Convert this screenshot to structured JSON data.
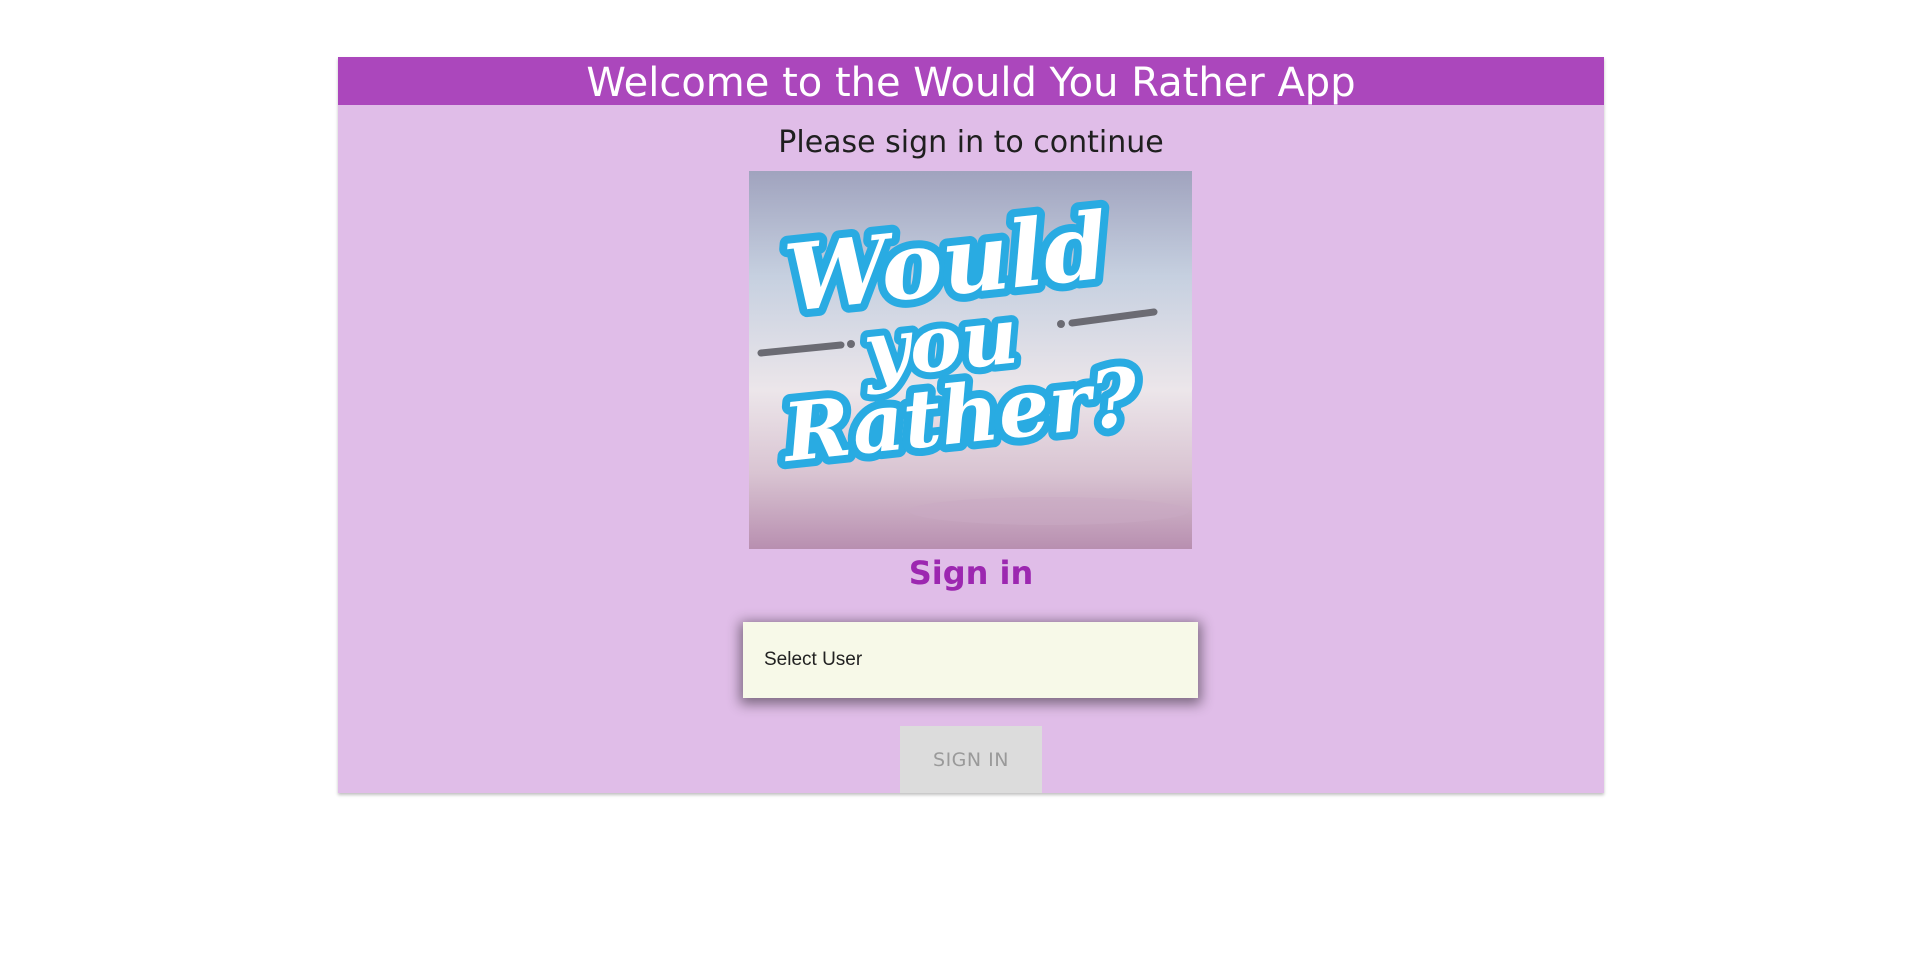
{
  "header": {
    "title": "Welcome to the Would You Rather App"
  },
  "subtitle": "Please sign in to continue",
  "logo": {
    "line1": "Would",
    "line2": "you",
    "line3": "Rather?",
    "text_color": "#ffffff",
    "outline_color": "#29abe2"
  },
  "signin": {
    "heading": "Sign in",
    "user_select_placeholder": "Select User",
    "button_label": "SIGN IN",
    "button_disabled": true
  },
  "colors": {
    "header_bg": "#ab47bc",
    "card_bg": "#e0bde8",
    "heading_color": "#9c27b0",
    "select_bg": "#f7f9e8",
    "button_bg": "#dcdcdc"
  }
}
